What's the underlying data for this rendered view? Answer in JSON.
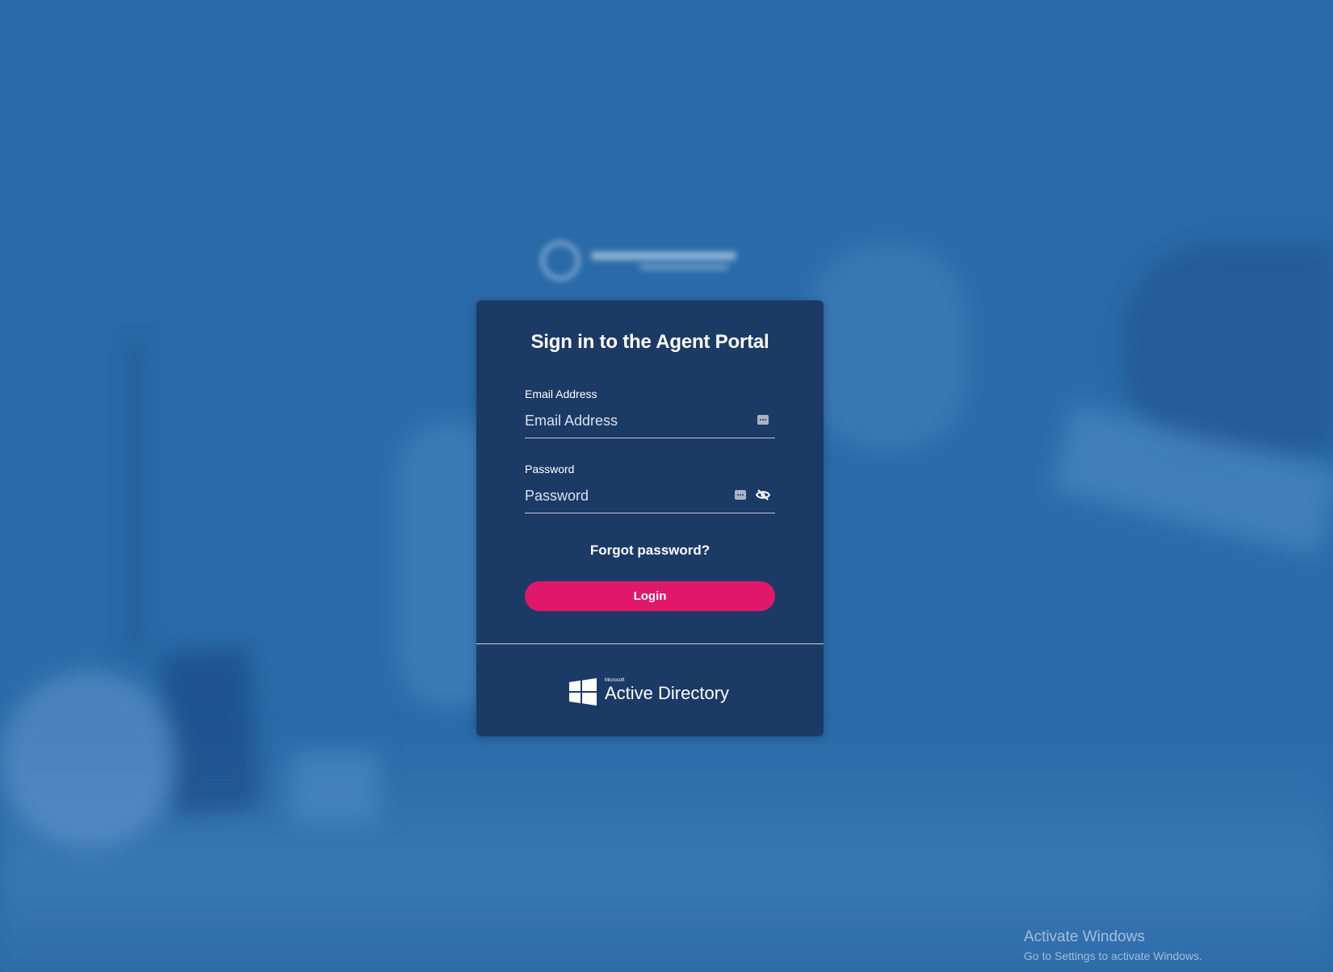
{
  "login_card": {
    "title": "Sign in to the Agent Portal",
    "email": {
      "label": "Email Address",
      "placeholder": "Email Address",
      "value": ""
    },
    "password": {
      "label": "Password",
      "placeholder": "Password",
      "value": ""
    },
    "forgot_password": "Forgot password?",
    "login_button": "Login",
    "sso": {
      "provider_micro": "Microsoft",
      "provider_label": "Active Directory",
      "icon": "windows-logo-icon"
    }
  },
  "watermark": {
    "title": "Activate Windows",
    "subtitle": "Go to Settings to activate Windows."
  },
  "colors": {
    "background": "#2a6aa8",
    "card": "#1c3a66",
    "login_button": "#e0186a"
  }
}
